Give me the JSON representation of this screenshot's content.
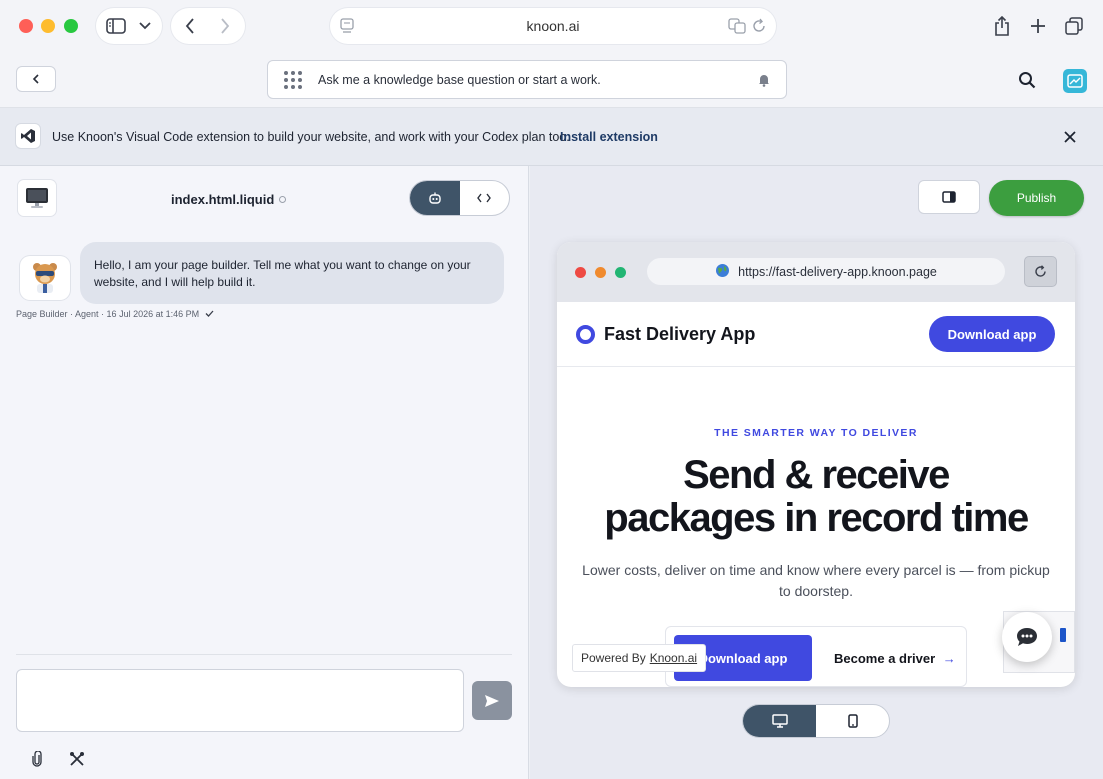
{
  "browser": {
    "url": "knoon.ai"
  },
  "appbar": {
    "ask_placeholder": "Ask me a knowledge base question or start a work."
  },
  "notice": {
    "text": "Use Knoon's Visual Code extension to build your website, and work with your Codex plan too.",
    "link": "Install extension"
  },
  "builder": {
    "file_name": "index.html.liquid",
    "message": "Hello, I am your page builder. Tell me what you want to change on your website, and I will help build it.",
    "meta": "Page Builder · Agent · 16 Jul 2026 at 1:46 PM"
  },
  "toolbar": {
    "publish_label": "Publish"
  },
  "preview": {
    "url": "https://fast-delivery-app.knoon.page",
    "site_name": "Fast Delivery App",
    "header_cta": "Download app",
    "eyebrow": "THE SMARTER WAY TO DELIVER",
    "headline_line1": "Send & receive",
    "headline_line2": "packages in record time",
    "subtext": "Lower costs, deliver on time and know where every parcel is — from pickup to doorstep.",
    "cta_primary": "Download app",
    "cta_secondary": "Become a driver",
    "powered_prefix": "Powered By",
    "powered_link": "Knoon.ai"
  },
  "colors": {
    "accent": "#4049e0",
    "publish": "#3c9e3f",
    "toggle_active": "#3f5468"
  }
}
